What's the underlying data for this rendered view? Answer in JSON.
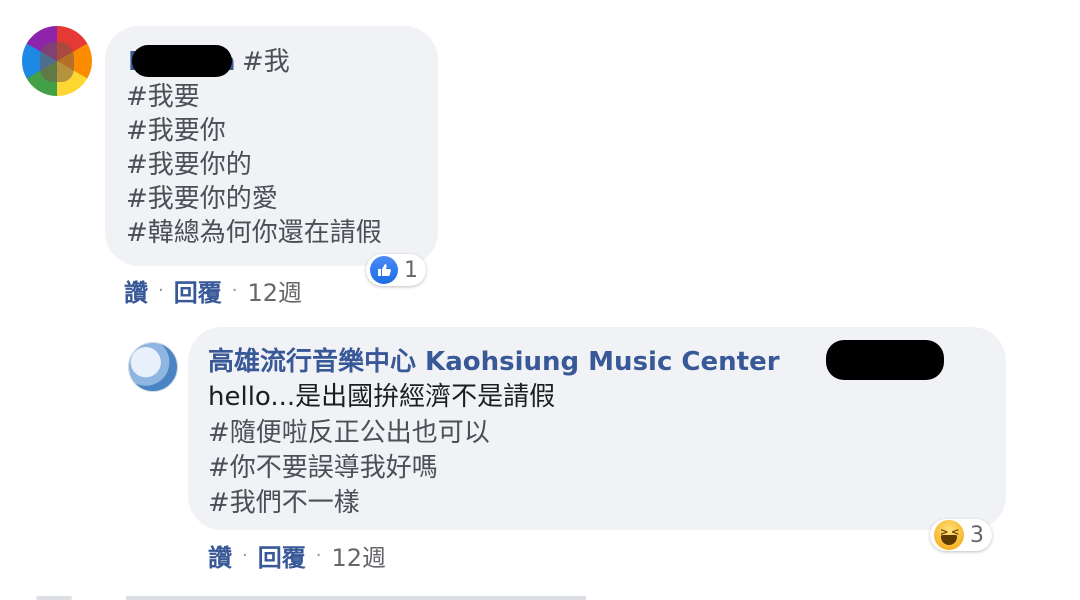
{
  "comment1": {
    "author_prefix": "D",
    "author_suffix": "a",
    "first_line_tag": "#我",
    "lines": [
      "#我要",
      "#我要你",
      "#我要你的",
      "#我要你的愛",
      "#韓總為何你還在請假"
    ],
    "reaction": {
      "icon": "like-icon",
      "count": "1"
    },
    "actions": {
      "like": "讚",
      "reply": "回覆",
      "time": "12週"
    }
  },
  "comment2": {
    "author": "高雄流行音樂中心 Kaohsiung Music Center",
    "lines": [
      "hello...是出國拚經濟不是請假",
      "#隨便啦反正公出也可以",
      "#你不要誤導我好嗎",
      "#我們不一樣"
    ],
    "reaction": {
      "icon": "haha-icon",
      "count": "3"
    },
    "actions": {
      "like": "讚",
      "reply": "回覆",
      "time": "12週"
    }
  },
  "separator": "·",
  "colors": {
    "bubble": "#f0f2f5",
    "link": "#385898",
    "text": "#4b4f56",
    "meta": "#65676b"
  }
}
